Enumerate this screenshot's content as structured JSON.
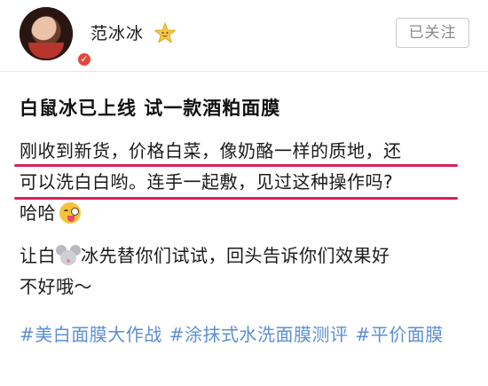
{
  "user": {
    "name": "范冰冰",
    "follow_label": "已关注",
    "verified_badge": "✓"
  },
  "post": {
    "title": "白鼠冰已上线 试一款酒粕面膜",
    "paragraph1": {
      "line1": "刚收到新货，价格白菜，像奶酪一样的质地，还",
      "line2": "可以洗白白哟。连手一起敷，见过这种操作吗?",
      "line3": "哈哈"
    },
    "paragraph2": {
      "part1": "让白",
      "part2": "冰先替你们试试，回头告诉你们效果好",
      "line2": "不好哦～"
    },
    "tags": [
      "#美白面膜大作战",
      "#涂抹式水洗面膜测评",
      "#平价面膜"
    ]
  },
  "icons": {
    "star": "star-icon",
    "emoji": "tongue-wink-emoji-icon",
    "mouse": "mouse-face-icon"
  },
  "colors": {
    "underline": "#d8205c",
    "tag": "#5b8fd6",
    "star": "#f5c84a"
  }
}
